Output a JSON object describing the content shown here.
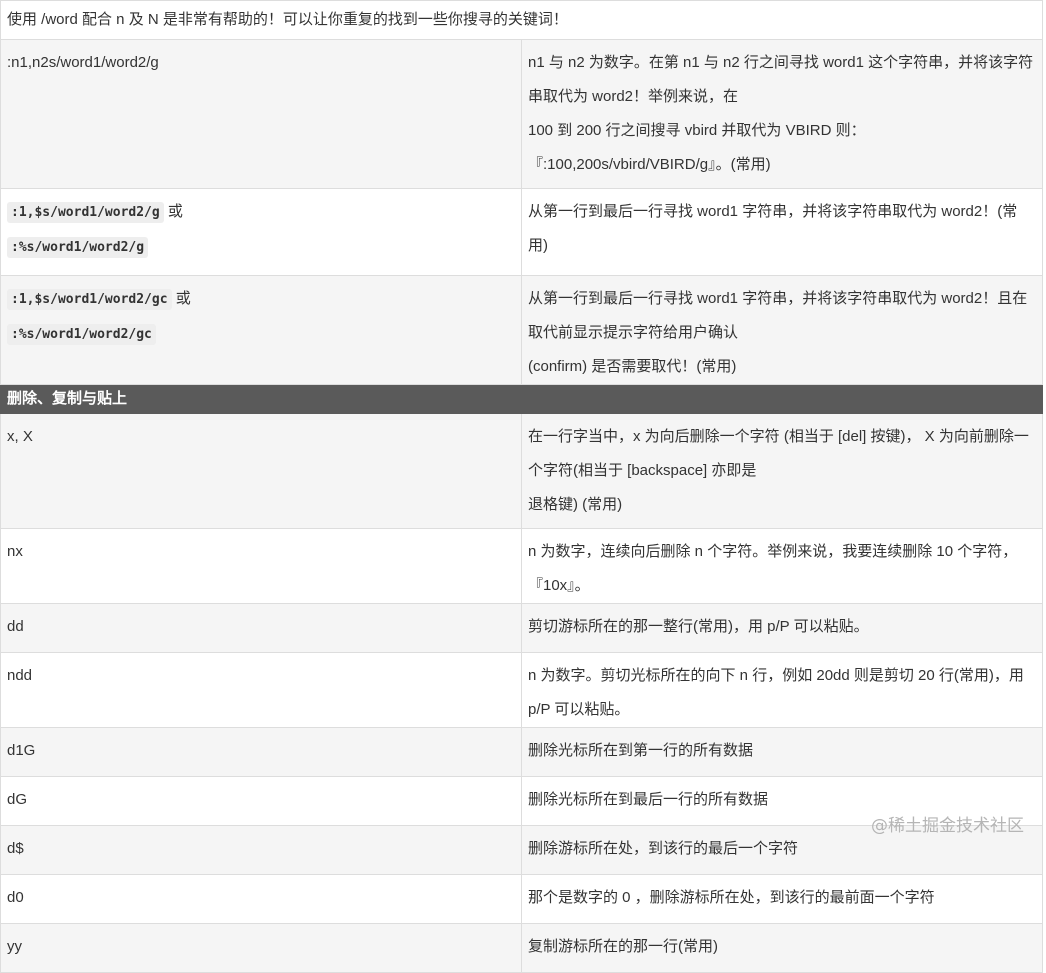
{
  "intro": "使用 /word 配合 n 及 N 是非常有帮助的！可以让你重复的找到一些你搜寻的关键词！",
  "search_rows": [
    {
      "cmd": ":n1,n2s/word1/word2/g",
      "desc_lines": [
        "n1 与 n2 为数字。在第 n1 与 n2 行之间寻找 word1 这个字符串，并将该字符串取代为 word2！举例来说，在",
        "100 到 200 行之间搜寻 vbird 并取代为 VBIRD 则：",
        "『:100,200s/vbird/VBIRD/g』。(常用)"
      ]
    },
    {
      "cmd_code_1": ":1,$s/word1/word2/g",
      "cmd_or": "或",
      "cmd_code_2": ":%s/word1/word2/g",
      "desc": "从第一行到最后一行寻找 word1 字符串，并将该字符串取代为 word2！(常用)"
    },
    {
      "cmd_code_1": ":1,$s/word1/word2/gc",
      "cmd_or": "或",
      "cmd_code_2": ":%s/word1/word2/gc",
      "desc_lines": [
        "从第一行到最后一行寻找 word1 字符串，并将该字符串取代为 word2！且在取代前显示提示字符给用户确认",
        "(confirm) 是否需要取代！(常用)"
      ]
    }
  ],
  "section_title": "删除、复制与贴上",
  "delete_rows": [
    {
      "cmd": "x, X",
      "desc_lines": [
        "在一行字当中，x 为向后删除一个字符 (相当于 [del] 按键)， X 为向前删除一个字符(相当于 [backspace] 亦即是",
        "退格键) (常用)"
      ]
    },
    {
      "cmd": "nx",
      "desc": "n 为数字，连续向后删除 n 个字符。举例来说，我要连续删除 10 个字符，『10x』。"
    },
    {
      "cmd": "dd",
      "desc": "剪切游标所在的那一整行(常用)，用 p/P 可以粘贴。"
    },
    {
      "cmd": "ndd",
      "desc": "n 为数字。剪切光标所在的向下 n 行，例如 20dd 则是剪切 20 行(常用)，用 p/P 可以粘贴。"
    },
    {
      "cmd": "d1G",
      "desc": "删除光标所在到第一行的所有数据"
    },
    {
      "cmd": "dG",
      "desc": "删除光标所在到最后一行的所有数据"
    },
    {
      "cmd": "d$",
      "desc": "删除游标所在处，到该行的最后一个字符"
    },
    {
      "cmd": "d0",
      "desc": "那个是数字的 0 ，删除游标所在处，到该行的最前面一个字符"
    },
    {
      "cmd": "yy",
      "desc": "复制游标所在的那一行(常用)"
    }
  ],
  "watermark": "@稀土掘金技术社区"
}
